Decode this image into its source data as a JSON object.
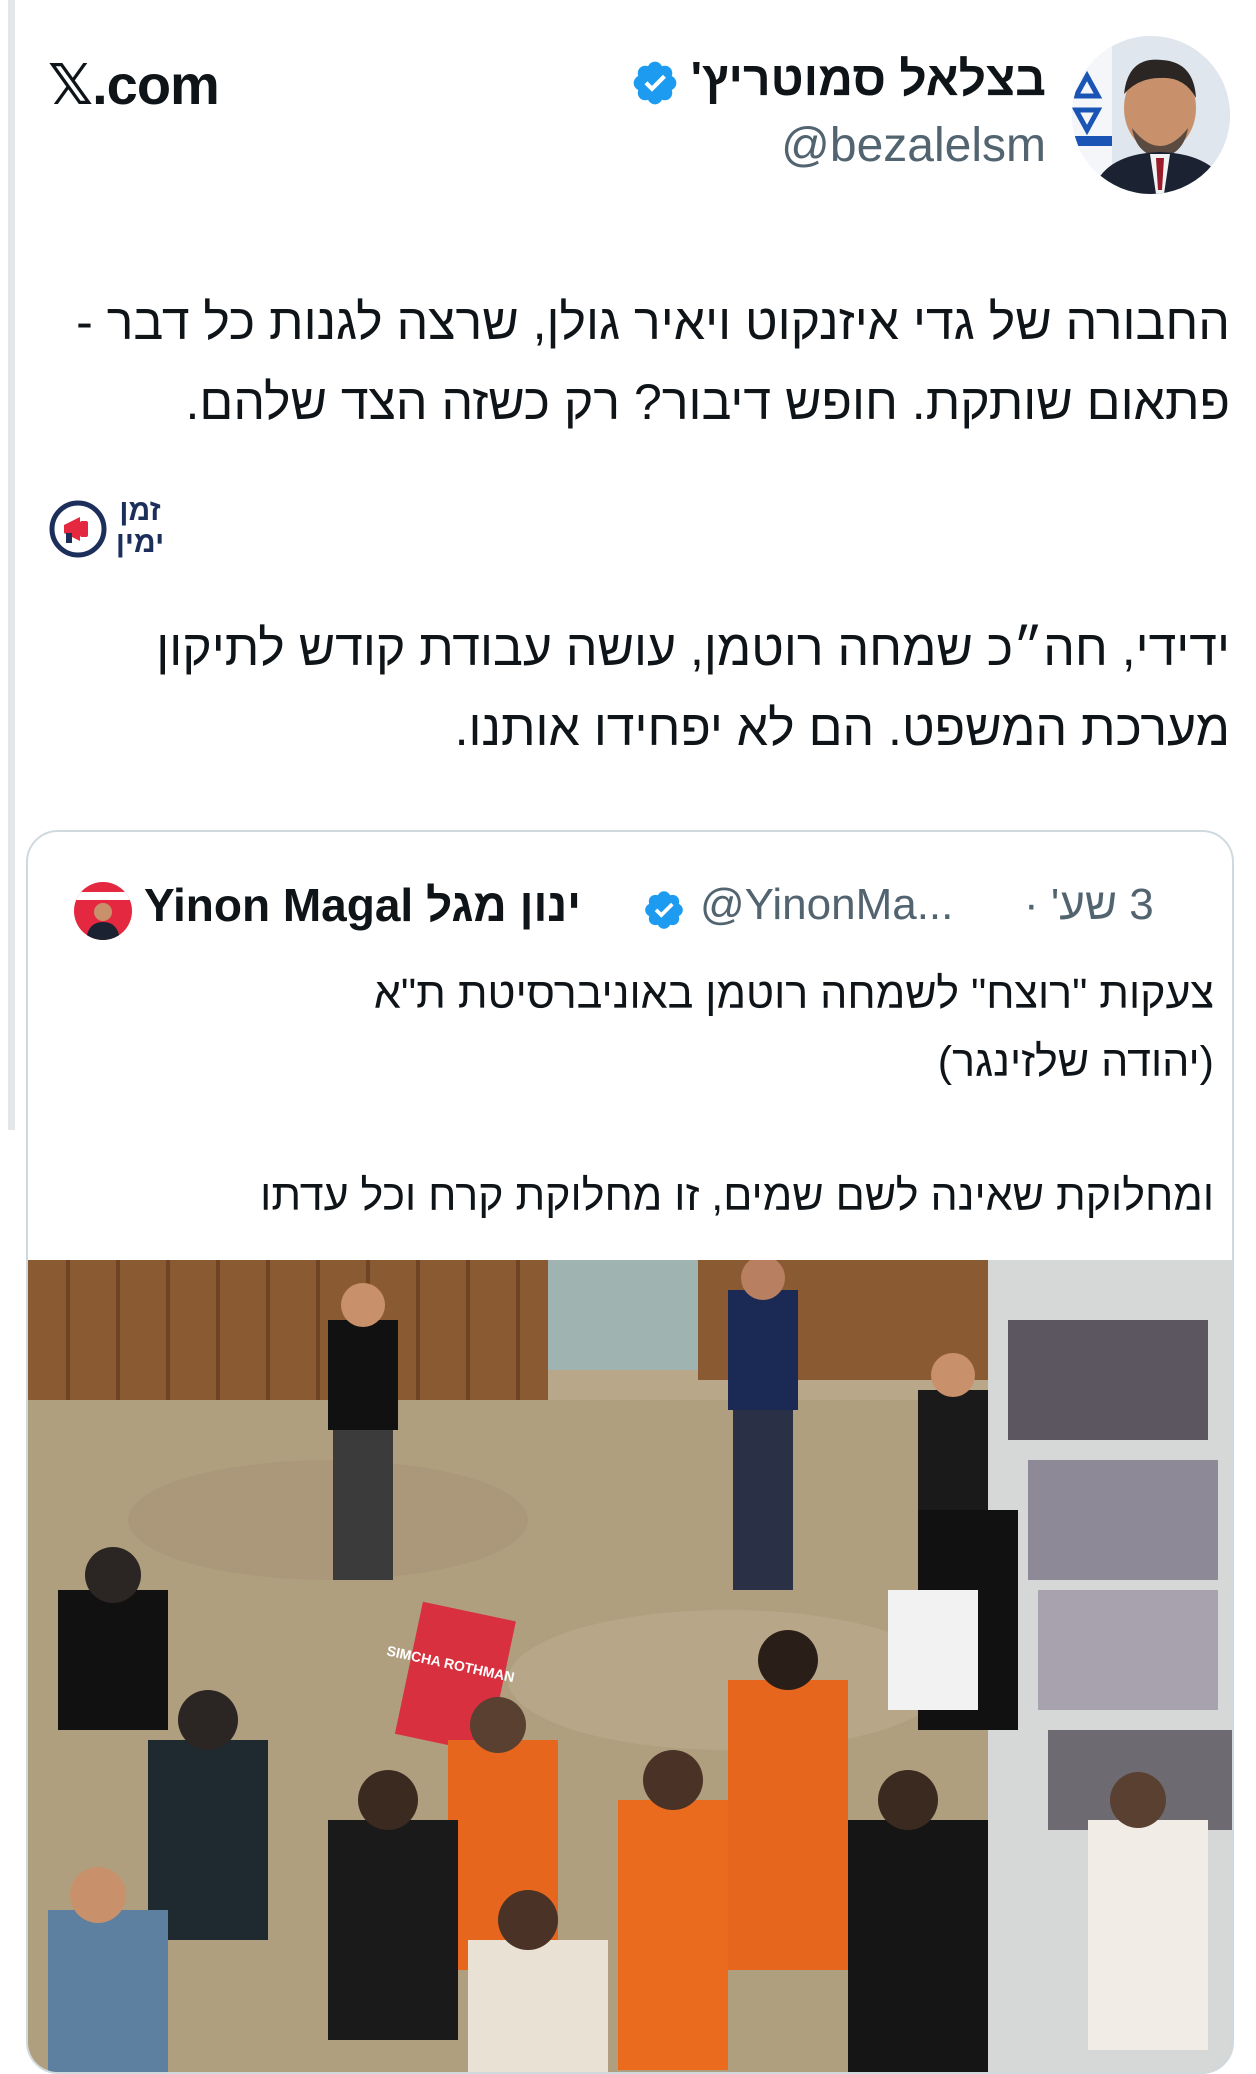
{
  "site": "𝕏.com",
  "tweet": {
    "author_name": "בצלאל סמוטריץ'",
    "handle": "@bezalelsm",
    "paragraph1": "החבורה של גדי איזנקוט ויאיר גולן, שרצה לגנות כל דבר - פתאום שותקת. חופש דיבור? רק כשזה הצד שלהם.",
    "paragraph2": "ידידי, חה״כ שמחה רוטמן, עושה עבודת קודש לתיקון מערכת המשפט. הם לא יפחידו אותנו."
  },
  "watermark": {
    "line1": "זמן",
    "line2": "ימין"
  },
  "quoted": {
    "author_name": "Yinon Magal ינון מגל",
    "handle": "@YinonMa...",
    "time": "3 שע' ·",
    "line1": "צעקות \"רוצח\" לשמחה רוטמן באוניברסיטת ת\"א",
    "line2": "(יהודה  שלזינגר)",
    "line3": "ומחלוקת שאינה לשם שמים, זו מחלוקת קרח וכל עדתו",
    "sign_text": "SIMCHA ROTHMAN"
  },
  "colors": {
    "verified": "#1d9bf0",
    "text": "#0f1419",
    "secondary": "#536471",
    "border": "#cfd9de",
    "watermark_red": "#e3283f",
    "watermark_navy": "#1b2f5a"
  },
  "icons": [
    "x-logo-icon",
    "verified-badge-icon",
    "megaphone-clock-icon",
    "avatar-image"
  ]
}
